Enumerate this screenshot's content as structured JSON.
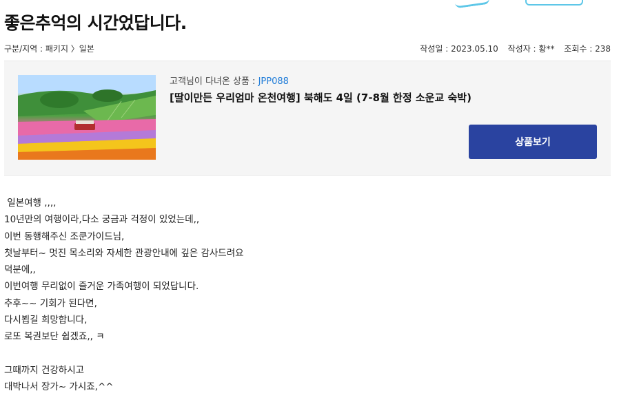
{
  "post": {
    "title": "좋은추억의 시간었답니다.",
    "category": "구분/지역 : 패키지 〉일본",
    "date": "작성일 : 2023.05.10",
    "author": "작성자 : 황**",
    "views": "조회수 : 238"
  },
  "product": {
    "label": "고객님이 다녀온 상품 : ",
    "code": "JPP088",
    "name": "[딸이만든 우리엄마 온천여행] 북해도 4일 (7-8월 한정 소운교 숙박)",
    "button_label": "상품보기",
    "image_desc": "flower-field-photo"
  },
  "body": {
    "lines": [
      " 일본여행 ,,,,",
      "10년만의 여행이라,다소 궁금과 걱정이 있었는데,,",
      "이번 동행해주신 조쿤가이드님,",
      "첫날부터~ 멋진 목소리와 자세한 관광안내에 깊은 감사드려요",
      "덕분에,,",
      "이번여행 무리없이 즐거운 가족여행이 되었답니다.",
      "추후~~ 기회가 된다면,",
      "다시뵙길 희망합니다,",
      "로또 복권보단 쉽겠죠,, ㅋ",
      "",
      "그때까지 건강하시고",
      "대박나서 장가~ 가시죠,^^"
    ]
  }
}
